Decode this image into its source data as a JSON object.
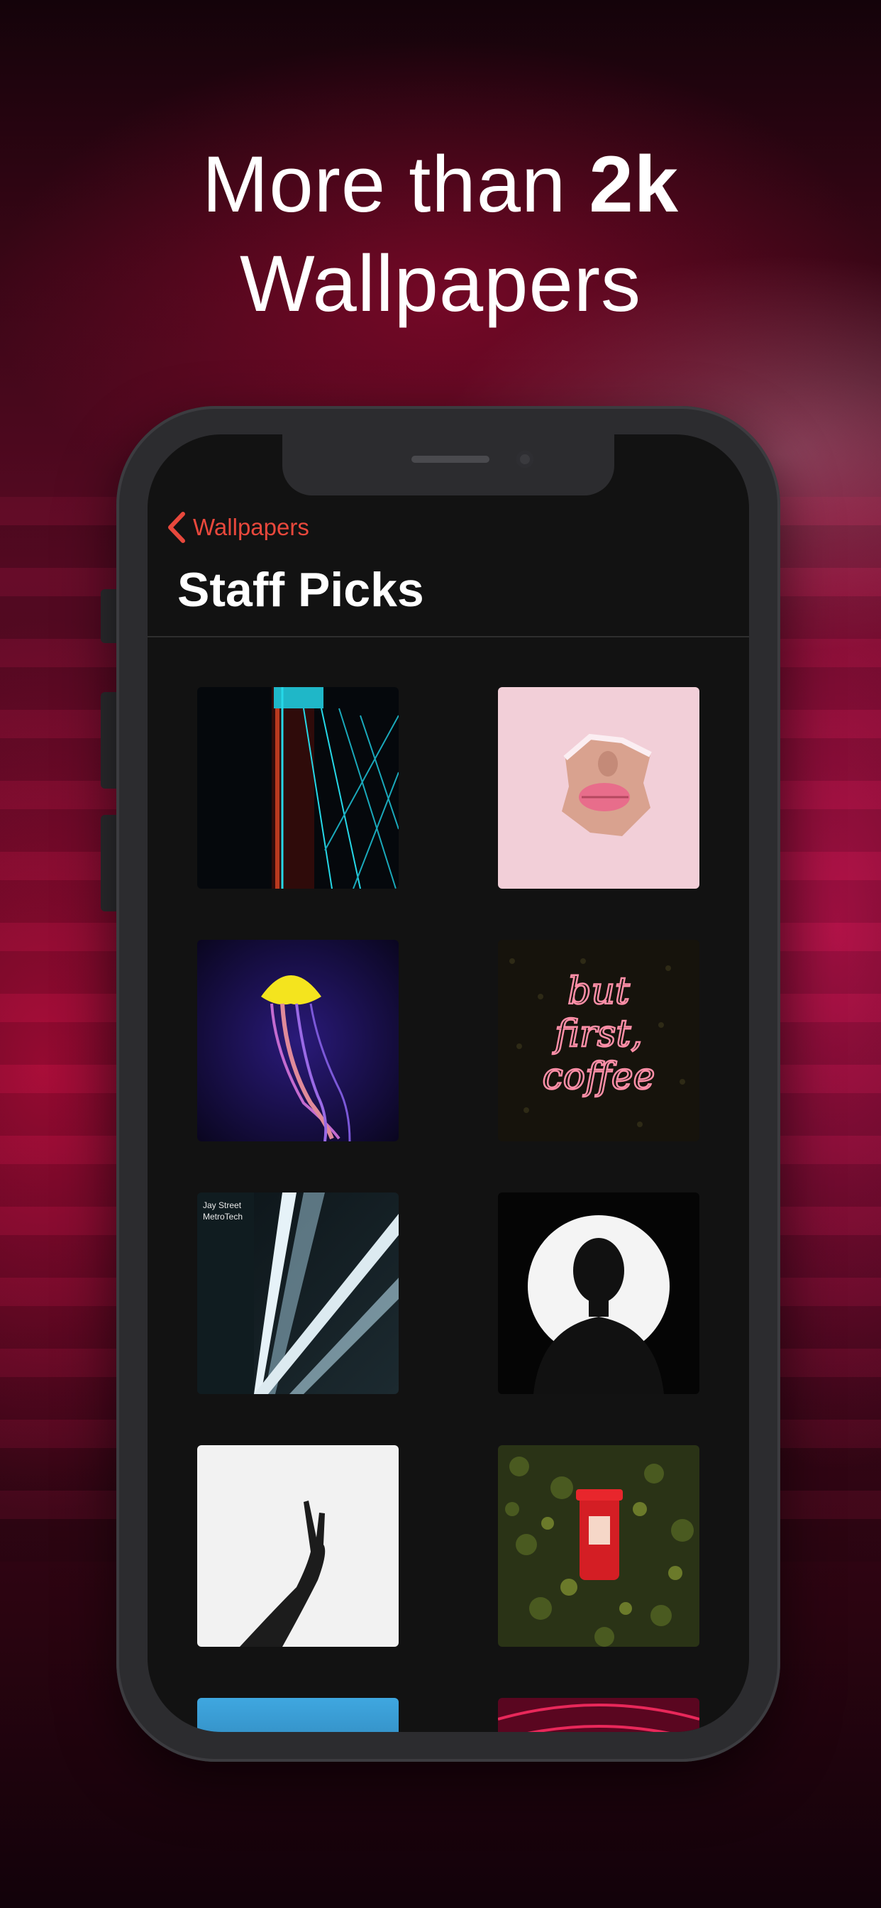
{
  "headline": {
    "line1_prefix": "More than ",
    "line1_bold": "2k",
    "line2": "Wallpapers"
  },
  "phone": {
    "nav": {
      "back_label": "Wallpapers",
      "back_icon": "chevron-left-icon",
      "accent_color": "#e8483c"
    },
    "title": "Staff Picks",
    "tiles": [
      {
        "name": "neon-lines-wallpaper"
      },
      {
        "name": "pink-lips-wallpaper"
      },
      {
        "name": "jellyfish-wallpaper"
      },
      {
        "name": "neon-sign-wallpaper",
        "sign_text": "but first coffee"
      },
      {
        "name": "subway-station-wallpaper",
        "sign_text": "Jay Street MetroTech"
      },
      {
        "name": "silhouette-wallpaper"
      },
      {
        "name": "hand-silhouette-wallpaper"
      },
      {
        "name": "mailbox-wallpaper"
      },
      {
        "name": "blue-gradient-wallpaper"
      },
      {
        "name": "red-tunnel-wallpaper"
      }
    ]
  }
}
